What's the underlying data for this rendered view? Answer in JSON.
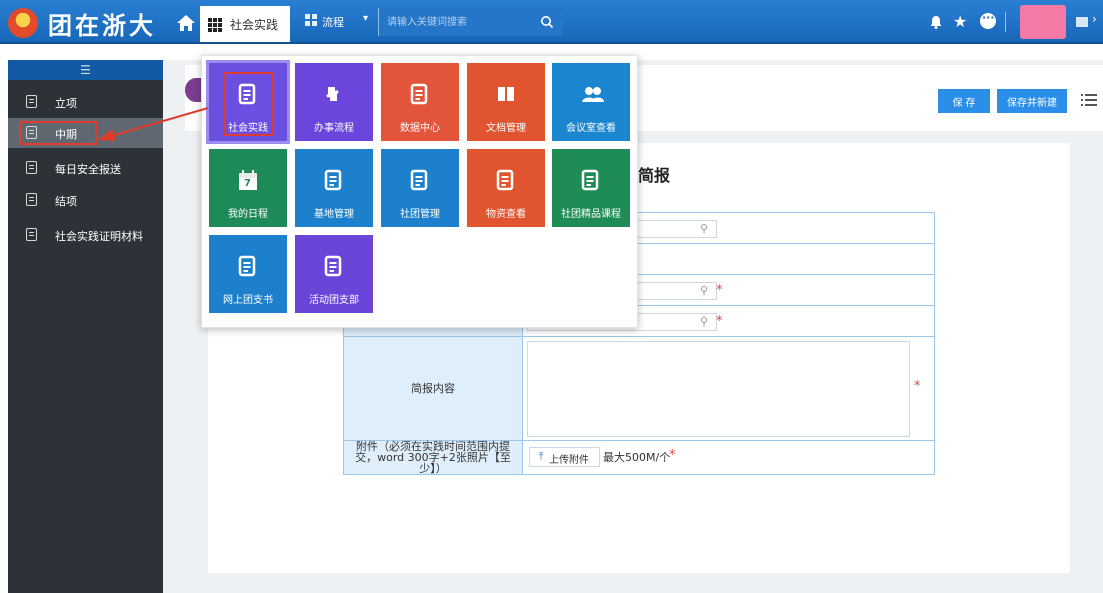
{
  "header": {
    "app_title": "团在浙大",
    "module_switch_label": "社会实践",
    "flow_label": "流程",
    "search_placeholder": "请输入关键词搜索"
  },
  "sidebar": {
    "items": [
      {
        "label": "立项"
      },
      {
        "label": "中期",
        "active": true
      },
      {
        "label": "每日安全报送"
      },
      {
        "label": "结项"
      },
      {
        "label": "社会实践证明材料"
      }
    ]
  },
  "module_panel": {
    "tiles": [
      {
        "label": "社会实践",
        "color": "#6a4fe0",
        "icon": "document-icon"
      },
      {
        "label": "办事流程",
        "color": "#6b45dc",
        "icon": "puzzle-icon"
      },
      {
        "label": "数据中心",
        "color": "#e2553b",
        "icon": "document-icon"
      },
      {
        "label": "文档管理",
        "color": "#e0552f",
        "icon": "book-icon"
      },
      {
        "label": "会议室查看",
        "color": "#1a86cf",
        "icon": "people-icon"
      },
      {
        "label": "我的日程",
        "color": "#1d8a58",
        "icon": "calendar-icon",
        "badge": "7"
      },
      {
        "label": "基地管理",
        "color": "#1d80cc",
        "icon": "document-icon"
      },
      {
        "label": "社团管理",
        "color": "#1d80cc",
        "icon": "document-icon"
      },
      {
        "label": "物资查看",
        "color": "#e0552f",
        "icon": "document-icon"
      },
      {
        "label": "社团精品课程",
        "color": "#1f8b55",
        "icon": "document-icon"
      },
      {
        "label": "网上团支书",
        "color": "#1d80cc",
        "icon": "document-icon"
      },
      {
        "label": "活动团支部",
        "color": "#6a45d8",
        "icon": "document-icon"
      }
    ]
  },
  "toolbar": {
    "save_label": "保 存",
    "save_new_label": "保存并新建"
  },
  "form": {
    "title": "简报",
    "content_label": "简报内容",
    "attachment_label": "附件（必须在实践时间范围内提交，word 300字+2张照片【至少】）",
    "upload_label": "上传附件",
    "upload_limit": "最大500M/个",
    "required_mark": "*"
  }
}
